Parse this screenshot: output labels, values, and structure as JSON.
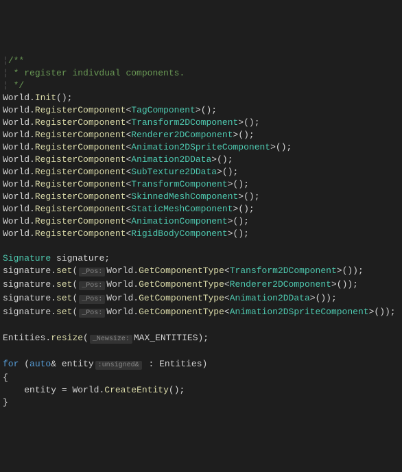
{
  "comment": {
    "l1": "/**",
    "l2": " * register indivdual components.",
    "l3": " */",
    "gutter": "¦"
  },
  "init": {
    "obj": "World",
    "method": "Init"
  },
  "register": {
    "obj": "World",
    "method": "RegisterComponent",
    "components": [
      "TagComponent",
      "Transform2DComponent",
      "Renderer2DComponent",
      "Animation2DSpriteComponent",
      "Animation2DData",
      "SubTexture2DData",
      "TransformComponent",
      "SkinnedMeshComponent",
      "StaticMeshComponent",
      "AnimationComponent",
      "RigidBodyComponent"
    ]
  },
  "signature": {
    "declType": "Signature",
    "var": "signature",
    "method": "set",
    "hint": "_Pos:",
    "getObj": "World",
    "getMethod": "GetComponentType",
    "types": [
      "Transform2DComponent",
      "Renderer2DComponent",
      "Animation2DData",
      "Animation2DSpriteComponent"
    ]
  },
  "resize": {
    "obj": "Entities",
    "method": "resize",
    "hint": "_Newsize:",
    "arg": "MAX_ENTITIES"
  },
  "loop": {
    "for": "for",
    "auto": "auto",
    "amp": "&",
    "var": "entity",
    "hint": ":unsigned&",
    "colon": ":",
    "coll": "Entities",
    "obj": "World",
    "method": "CreateEntity",
    "open": "{",
    "close": "}"
  }
}
